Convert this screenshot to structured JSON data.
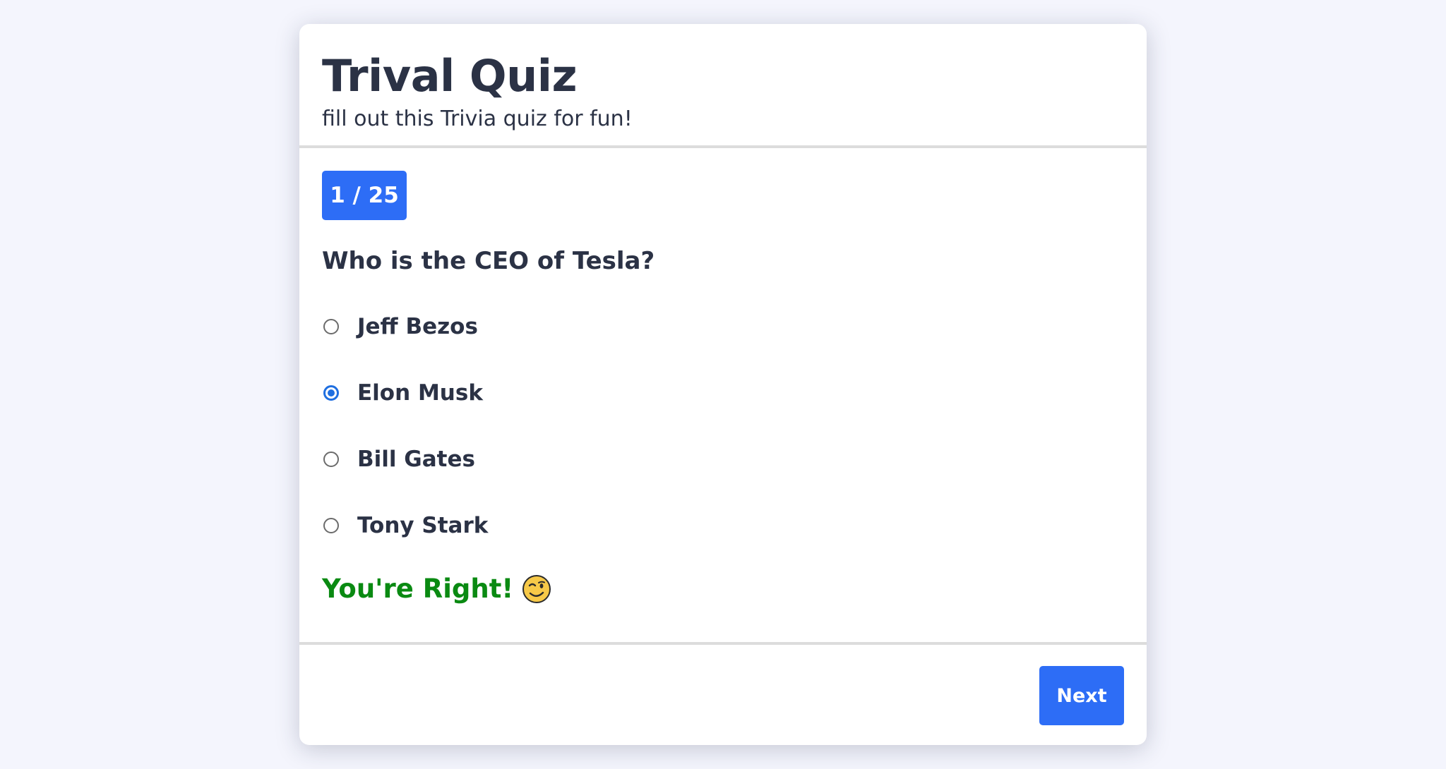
{
  "header": {
    "title": "Trival Quiz",
    "subtitle": "fill out this Trivia quiz for fun!"
  },
  "progress": {
    "label": "1 / 25"
  },
  "question": {
    "text": "Who is the CEO of Tesla?"
  },
  "options": [
    {
      "label": "Jeff Bezos",
      "selected": false
    },
    {
      "label": "Elon Musk",
      "selected": true
    },
    {
      "label": "Bill Gates",
      "selected": false
    },
    {
      "label": "Tony Stark",
      "selected": false
    }
  ],
  "feedback": {
    "text": "You're Right!",
    "icon": "winking-face-icon",
    "color": "#0a8a12"
  },
  "footer": {
    "next_label": "Next"
  },
  "colors": {
    "accent": "#2d6df6",
    "text": "#2b3245",
    "background": "#f4f5fd"
  }
}
